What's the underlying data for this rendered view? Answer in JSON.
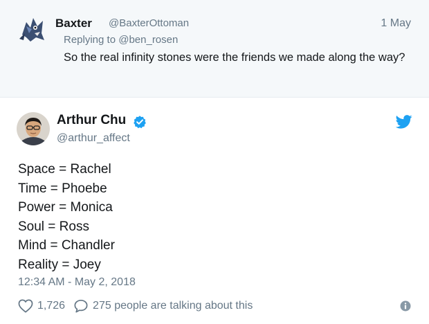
{
  "reply_tweet": {
    "display_name": "Baxter",
    "handle": "@BaxterOttoman",
    "date": "1 May",
    "replying_prefix": "Replying to",
    "replying_to": "@ben_rosen",
    "text": "So the real infinity stones were the friends we made along the way?",
    "avatar_icon": "blue-creature-avatar"
  },
  "main_tweet": {
    "display_name": "Arthur Chu",
    "handle": "@arthur_affect",
    "verified_icon": "verified-badge-icon",
    "brand_icon": "twitter-bird-icon",
    "lines": [
      "Space = Rachel",
      "Time = Phoebe",
      "Power = Monica",
      "Soul = Ross",
      "Mind = Chandler",
      "Reality = Joey"
    ],
    "timestamp": "12:34 AM - May 2, 2018",
    "like_count": "1,726",
    "talking_text": "275 people are talking about this"
  },
  "colors": {
    "twitter_blue": "#1da1f2",
    "muted_text": "#657786",
    "reply_background": "#f5f8fa"
  }
}
